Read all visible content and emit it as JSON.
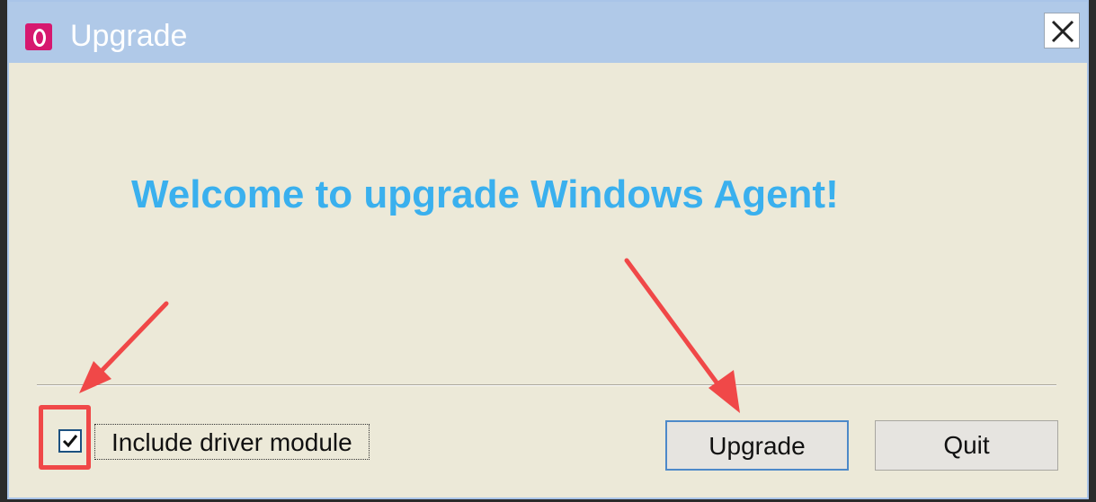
{
  "window": {
    "title": "Upgrade",
    "app_icon": "app-logo-icon",
    "close_icon": "close-icon"
  },
  "main": {
    "welcome_text": "Welcome to upgrade Windows Agent!"
  },
  "options": {
    "include_driver_label": "Include driver module",
    "include_driver_checked": true
  },
  "buttons": {
    "upgrade_label": "Upgrade",
    "quit_label": "Quit"
  },
  "colors": {
    "titlebar": "#b0c9e8",
    "background": "#ece9d8",
    "welcome_text": "#3ab0ee",
    "annotation": "#f04848",
    "app_icon": "#d6186f"
  }
}
